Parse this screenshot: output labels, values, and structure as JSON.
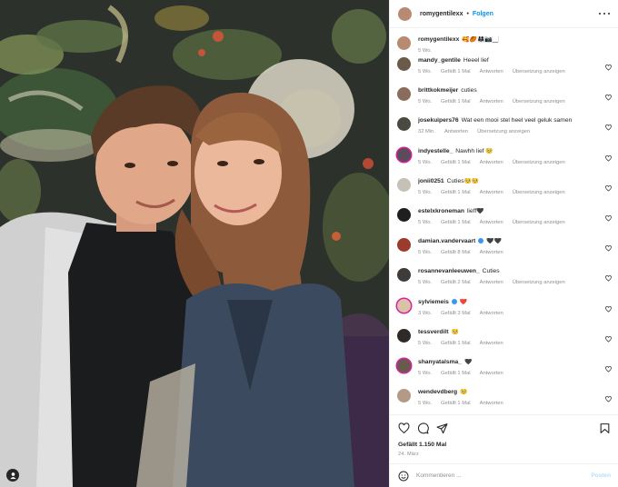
{
  "post": {
    "author": "romygentilexx",
    "follow_label": "Folgen",
    "separator": "•"
  },
  "caption": {
    "user": "romygentilexx",
    "text": "🥰🏉👨‍👩‍👧📷🏻",
    "time": "5 Wo."
  },
  "comments": [
    {
      "user": "mandy_gentile",
      "text": "Heeel lief",
      "time": "5 Wo.",
      "likes": "Gefällt 1 Mal",
      "reply": "Antworten",
      "translate": "Übersetzung anzeigen",
      "avatar_color": "#6b5a4a"
    },
    {
      "user": "brittkokmeijer",
      "text": "cuties",
      "time": "5 Wo.",
      "likes": "Gefällt 1 Mal",
      "reply": "Antworten",
      "translate": "Übersetzung anzeigen",
      "avatar_color": "#8a6c5c"
    },
    {
      "user": "josekuipers76",
      "text": "Wat een mooi stel heel veel geluk samen",
      "time": "32 Min.",
      "likes": "",
      "reply": "Antworten",
      "translate": "Übersetzung anzeigen",
      "avatar_color": "#4a4a42"
    },
    {
      "user": "indyestelle_",
      "text": "Nawhh lief 🥺",
      "time": "5 Wo.",
      "likes": "Gefällt 1 Mal",
      "reply": "Antworten",
      "translate": "Übersetzung anzeigen",
      "avatar_color": "#5c4b58"
    },
    {
      "user": "jonii0251",
      "text": "Cuties🥺🥺",
      "time": "5 Wo.",
      "likes": "Gefällt 1 Mal",
      "reply": "Antworten",
      "translate": "Übersetzung anzeigen",
      "avatar_color": "#c7c0b6"
    },
    {
      "user": "estelxkroneman",
      "text": "lieff🖤",
      "time": "5 Wo.",
      "likes": "Gefällt 1 Mal",
      "reply": "Antworten",
      "translate": "Übersetzung anzeigen",
      "avatar_color": "#1f1f1f"
    },
    {
      "user": "damian.vandervaart",
      "text": "🖤🖤",
      "time": "5 Wo.",
      "likes": "Gefällt 8 Mal",
      "reply": "Antworten",
      "translate": "",
      "avatar_color": "#9a3b2b",
      "verified": true
    },
    {
      "user": "rosannevanleeuwen_",
      "text": "Cuties",
      "time": "5 Wo.",
      "likes": "Gefällt 2 Mal",
      "reply": "Antworten",
      "translate": "Übersetzung anzeigen",
      "avatar_color": "#3f3b38"
    },
    {
      "user": "sylviemeis",
      "text": "❤️",
      "time": "3 Wo.",
      "likes": "Gefällt 3 Mal",
      "reply": "Antworten",
      "translate": "",
      "avatar_color": "#d9c2a8",
      "verified": true
    },
    {
      "user": "tessverdilt",
      "text": "🥺",
      "time": "5 Wo.",
      "likes": "Gefällt 1 Mal",
      "reply": "Antworten",
      "translate": "",
      "avatar_color": "#2f2a28"
    },
    {
      "user": "shanyatalsma_",
      "text": "🖤",
      "time": "5 Wo.",
      "likes": "Gefällt 1 Mal",
      "reply": "Antworten",
      "translate": "",
      "avatar_color": "#6a5a4e"
    },
    {
      "user": "wendevdberg",
      "text": "🥺",
      "time": "5 Wo.",
      "likes": "Gefällt 1 Mal",
      "reply": "Antworten",
      "translate": "",
      "avatar_color": "#b49a86"
    }
  ],
  "actions": {
    "likes_text": "Gefällt 1.150 Mal",
    "date": "24. März"
  },
  "add_comment": {
    "placeholder": "Kommentieren ...",
    "post_label": "Posten"
  },
  "colors": {
    "link_blue": "#0095f6",
    "post_disabled": "#b2dffc",
    "muted": "#8e8e8e"
  }
}
